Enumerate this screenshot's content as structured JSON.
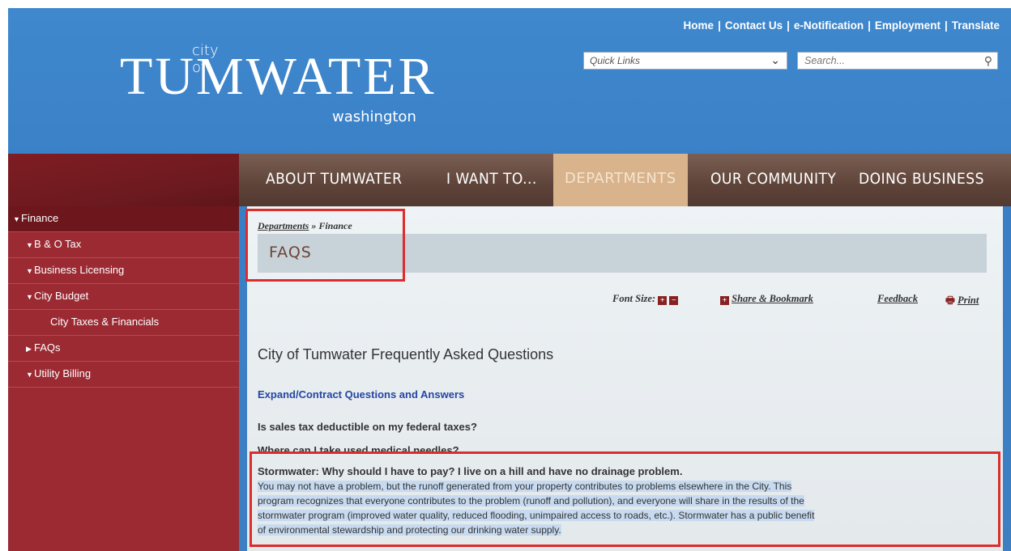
{
  "logo": {
    "city_of": "city of",
    "name": "TUMWATER",
    "state": "washington"
  },
  "top_links": [
    "Home",
    "Contact Us",
    "e-Notification",
    "Employment",
    "Translate"
  ],
  "quick_links": {
    "selected": "Quick Links"
  },
  "search": {
    "placeholder": "Search..."
  },
  "nav": {
    "items": [
      "ABOUT TUMWATER",
      "I WANT TO...",
      "DEPARTMENTS",
      "OUR COMMUNITY",
      "DOING BUSINESS"
    ],
    "active": "DEPARTMENTS"
  },
  "sidebar": {
    "items": [
      "Finance",
      "B & O Tax",
      "Business Licensing",
      "City Budget",
      "City Taxes & Financials",
      "FAQs",
      "Utility Billing"
    ]
  },
  "breadcrumb": {
    "parent": "Departments",
    "sep": "»",
    "current": "Finance"
  },
  "page_title": "FAQS",
  "tools": {
    "font_size": "Font Size:",
    "share": "Share & Bookmark",
    "feedback": "Feedback",
    "print": "Print"
  },
  "content": {
    "heading": "City of Tumwater Frequently Asked Questions",
    "expand": "Expand/Contract Questions and Answers",
    "questions": [
      "Is sales tax deductible on my federal taxes?",
      "Where can I take used medical needles?"
    ],
    "open_question": "Stormwater: Why should I have to pay? I live on a hill and have no drainage problem.",
    "answer_lines": [
      "You may not have a problem, but the runoff generated from your property contributes to problems elsewhere in the City. This",
      "program recognizes that everyone contributes to the problem (runoff and pollution), and everyone will share in the results of the",
      "stormwater program (improved water quality, reduced flooding, unimpaired access to roads, etc.). Stormwater has a public benefit",
      "of environmental stewardship and protecting our drinking water supply."
    ]
  },
  "colors": {
    "header_blue": "#3f88cd",
    "nav_brown": "#5e4339",
    "nav_active": "#d9b38c",
    "sidebar_red": "#9b2a33",
    "highlight_box": "#dd2c2c"
  }
}
